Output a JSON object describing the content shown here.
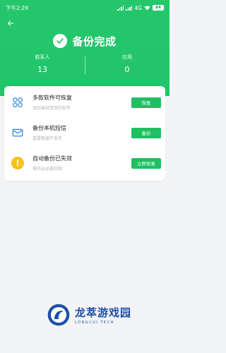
{
  "status_bar": {
    "time": "下午2:29",
    "network": "4G",
    "battery": "84"
  },
  "header": {
    "title": "备份完成"
  },
  "stats": [
    {
      "label": "联系人",
      "value": "13"
    },
    {
      "label": "应用",
      "value": "0"
    }
  ],
  "items": [
    {
      "title": "多款软件可恢复",
      "subtitle": "找回曾经常用的软件",
      "button": "恢复",
      "icon": "apps-grid-icon"
    },
    {
      "title": "备份本机短信",
      "subtitle": "重要数据不丢失",
      "button": "备份",
      "icon": "message-envelope-icon"
    },
    {
      "title": "自动备份已失效",
      "subtitle": "需开启必要权限",
      "button": "立即修复",
      "icon": "warning-icon"
    }
  ],
  "watermark": {
    "name": "龙萃游戏园",
    "sub": "LONGCUI TECH"
  },
  "colors": {
    "brand_green": "#22c46a",
    "button_green": "#1fbf62",
    "warning_yellow": "#f7c21b",
    "icon_blue": "#3a8de9"
  }
}
